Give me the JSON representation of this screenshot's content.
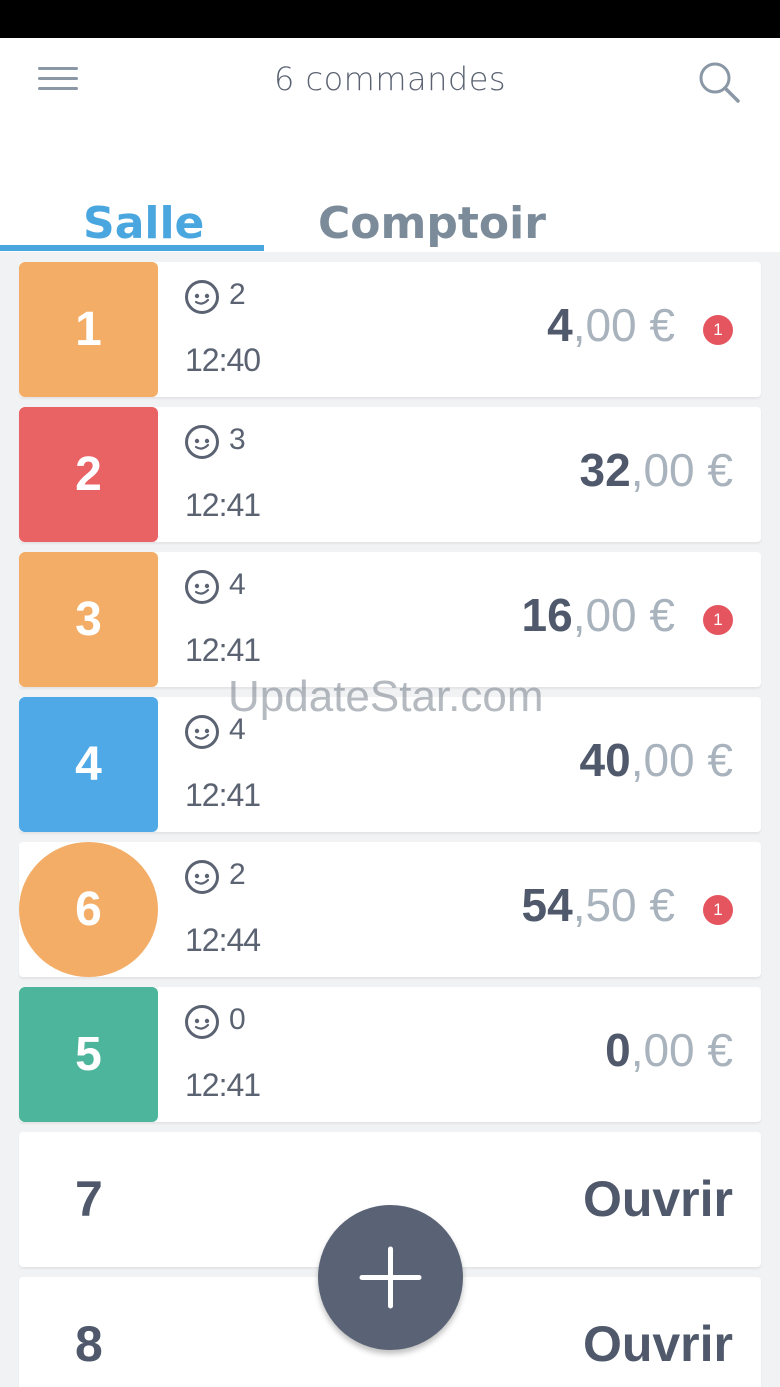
{
  "header": {
    "title": "6 commandes"
  },
  "tabs": [
    {
      "label": "Salle",
      "active": true
    },
    {
      "label": "Comptoir",
      "active": false
    }
  ],
  "orders": [
    {
      "table": "1",
      "guests": "2",
      "time": "12:40",
      "amount_int": "4",
      "amount_dec": ",00 €",
      "notifications": "1",
      "color": "#f3ad66"
    },
    {
      "table": "2",
      "guests": "3",
      "time": "12:41",
      "amount_int": "32",
      "amount_dec": ",00 €",
      "notifications": "",
      "color": "#e96264"
    },
    {
      "table": "3",
      "guests": "4",
      "time": "12:41",
      "amount_int": "16",
      "amount_dec": ",00 €",
      "notifications": "1",
      "color": "#f3ad66"
    },
    {
      "table": "4",
      "guests": "4",
      "time": "12:41",
      "amount_int": "40",
      "amount_dec": ",00 €",
      "notifications": "",
      "color": "#4fa9e6"
    },
    {
      "table": "6",
      "guests": "2",
      "time": "12:44",
      "amount_int": "54",
      "amount_dec": ",50 €",
      "notifications": "1",
      "color": "#f3ad66"
    },
    {
      "table": "5",
      "guests": "0",
      "time": "12:41",
      "amount_int": "0",
      "amount_dec": ",00 €",
      "notifications": "",
      "color": "#4db59b"
    }
  ],
  "empty_tables": [
    {
      "table": "7",
      "action": "Ouvrir"
    },
    {
      "table": "8",
      "action": "Ouvrir"
    }
  ],
  "icons": {
    "menu": "hamburger-icon",
    "search": "search-icon",
    "guests": "face-icon",
    "add": "plus-icon"
  },
  "colors": {
    "accent": "#4aa6df",
    "notification": "#e5555f",
    "fab": "#5a6375"
  },
  "watermark": "UpdateStar.com"
}
